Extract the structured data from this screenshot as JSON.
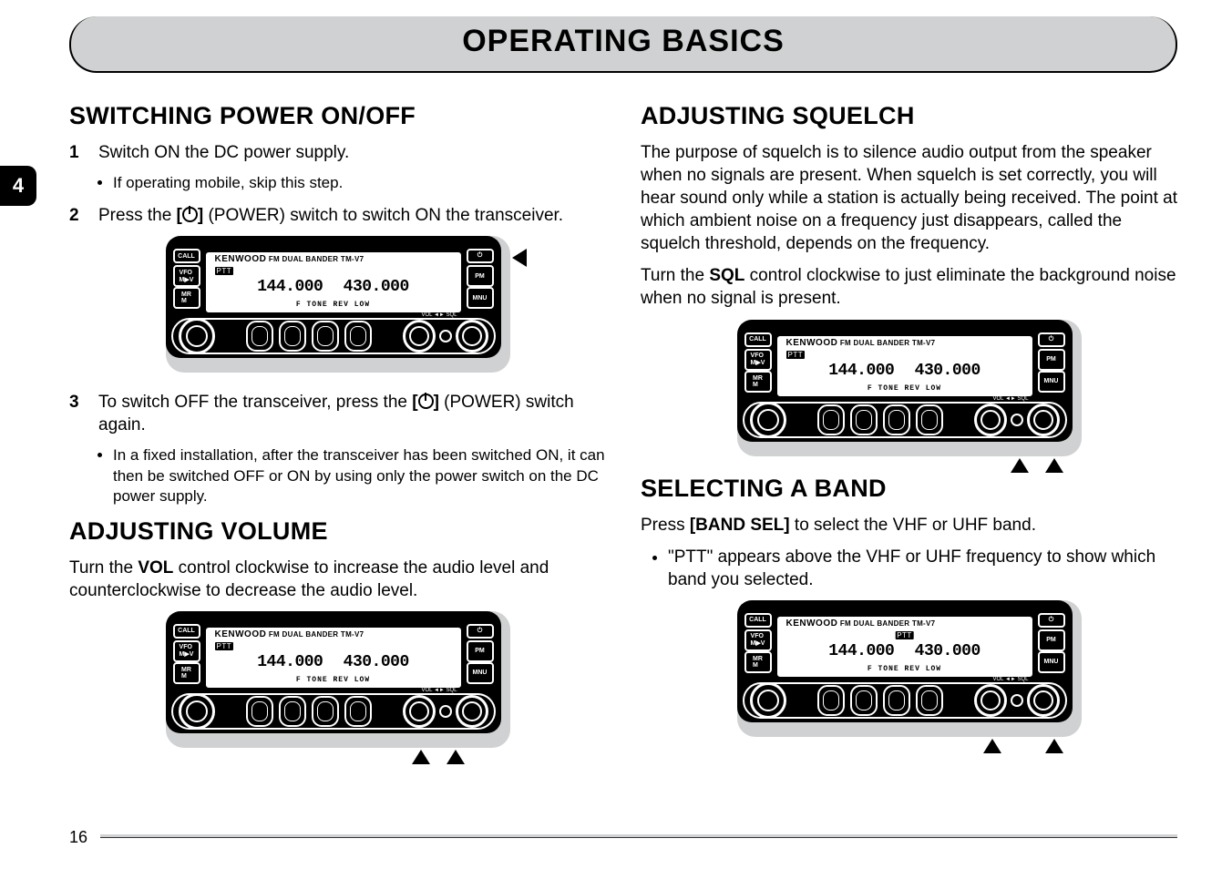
{
  "tab_number": "4",
  "page_number": "16",
  "page_title": "OPERATING BASICS",
  "left": {
    "h_power": "SWITCHING POWER ON/OFF",
    "step1_num": "1",
    "step1": "Switch ON the DC power supply.",
    "step1_sub": "If operating mobile, skip this step.",
    "step2_num": "2",
    "step2_a": "Press the ",
    "step2_b": " (POWER) switch to switch ON the transceiver.",
    "step2_bold": "[   ]",
    "step3_num": "3",
    "step3_a": "To switch OFF the transceiver, press the ",
    "step3_b": " (POWER) switch again.",
    "step3_sub": "In a fixed installation, after the transceiver has been switched ON, it can then be switched OFF or ON by using only the power switch on the DC power supply.",
    "h_volume": "ADJUSTING VOLUME",
    "vol_para_a": "Turn the ",
    "vol_bold": "VOL",
    "vol_para_b": " control clockwise to increase the audio level and counterclockwise to decrease the audio level."
  },
  "right": {
    "h_squelch": "ADJUSTING SQUELCH",
    "sq_para": "The purpose of squelch is to silence audio output from the speaker when no signals are present.  When squelch is set correctly, you will hear sound only while a station is actually being received.  The point at which ambient noise on a frequency just disappears, called the squelch threshold, depends on the frequency.",
    "sq_turn_a": "Turn the ",
    "sq_bold": "SQL",
    "sq_turn_b": " control clockwise to just eliminate the background noise when no signal is present.",
    "h_band": "SELECTING A BAND",
    "band_a": "Press ",
    "band_bold": "[BAND SEL]",
    "band_b": " to select the VHF or UHF band.",
    "band_bullet": "\"PTT\" appears above the VHF or UHF frequency to show which band you selected."
  },
  "radio": {
    "brand": "KENWOOD",
    "brand_sub": " FM DUAL BANDER  TM-V7",
    "ptt": "PTT",
    "freq": "144.000  430.000",
    "anno": "F  TONE REV  LOW",
    "volsql": "VOL ◄► SQL",
    "btn_call": "CALL",
    "btn_vfo": "VFO\nM▶V",
    "btn_mr": "MR\nM",
    "btn_pm": "PM",
    "btn_mnu": "MNU"
  }
}
